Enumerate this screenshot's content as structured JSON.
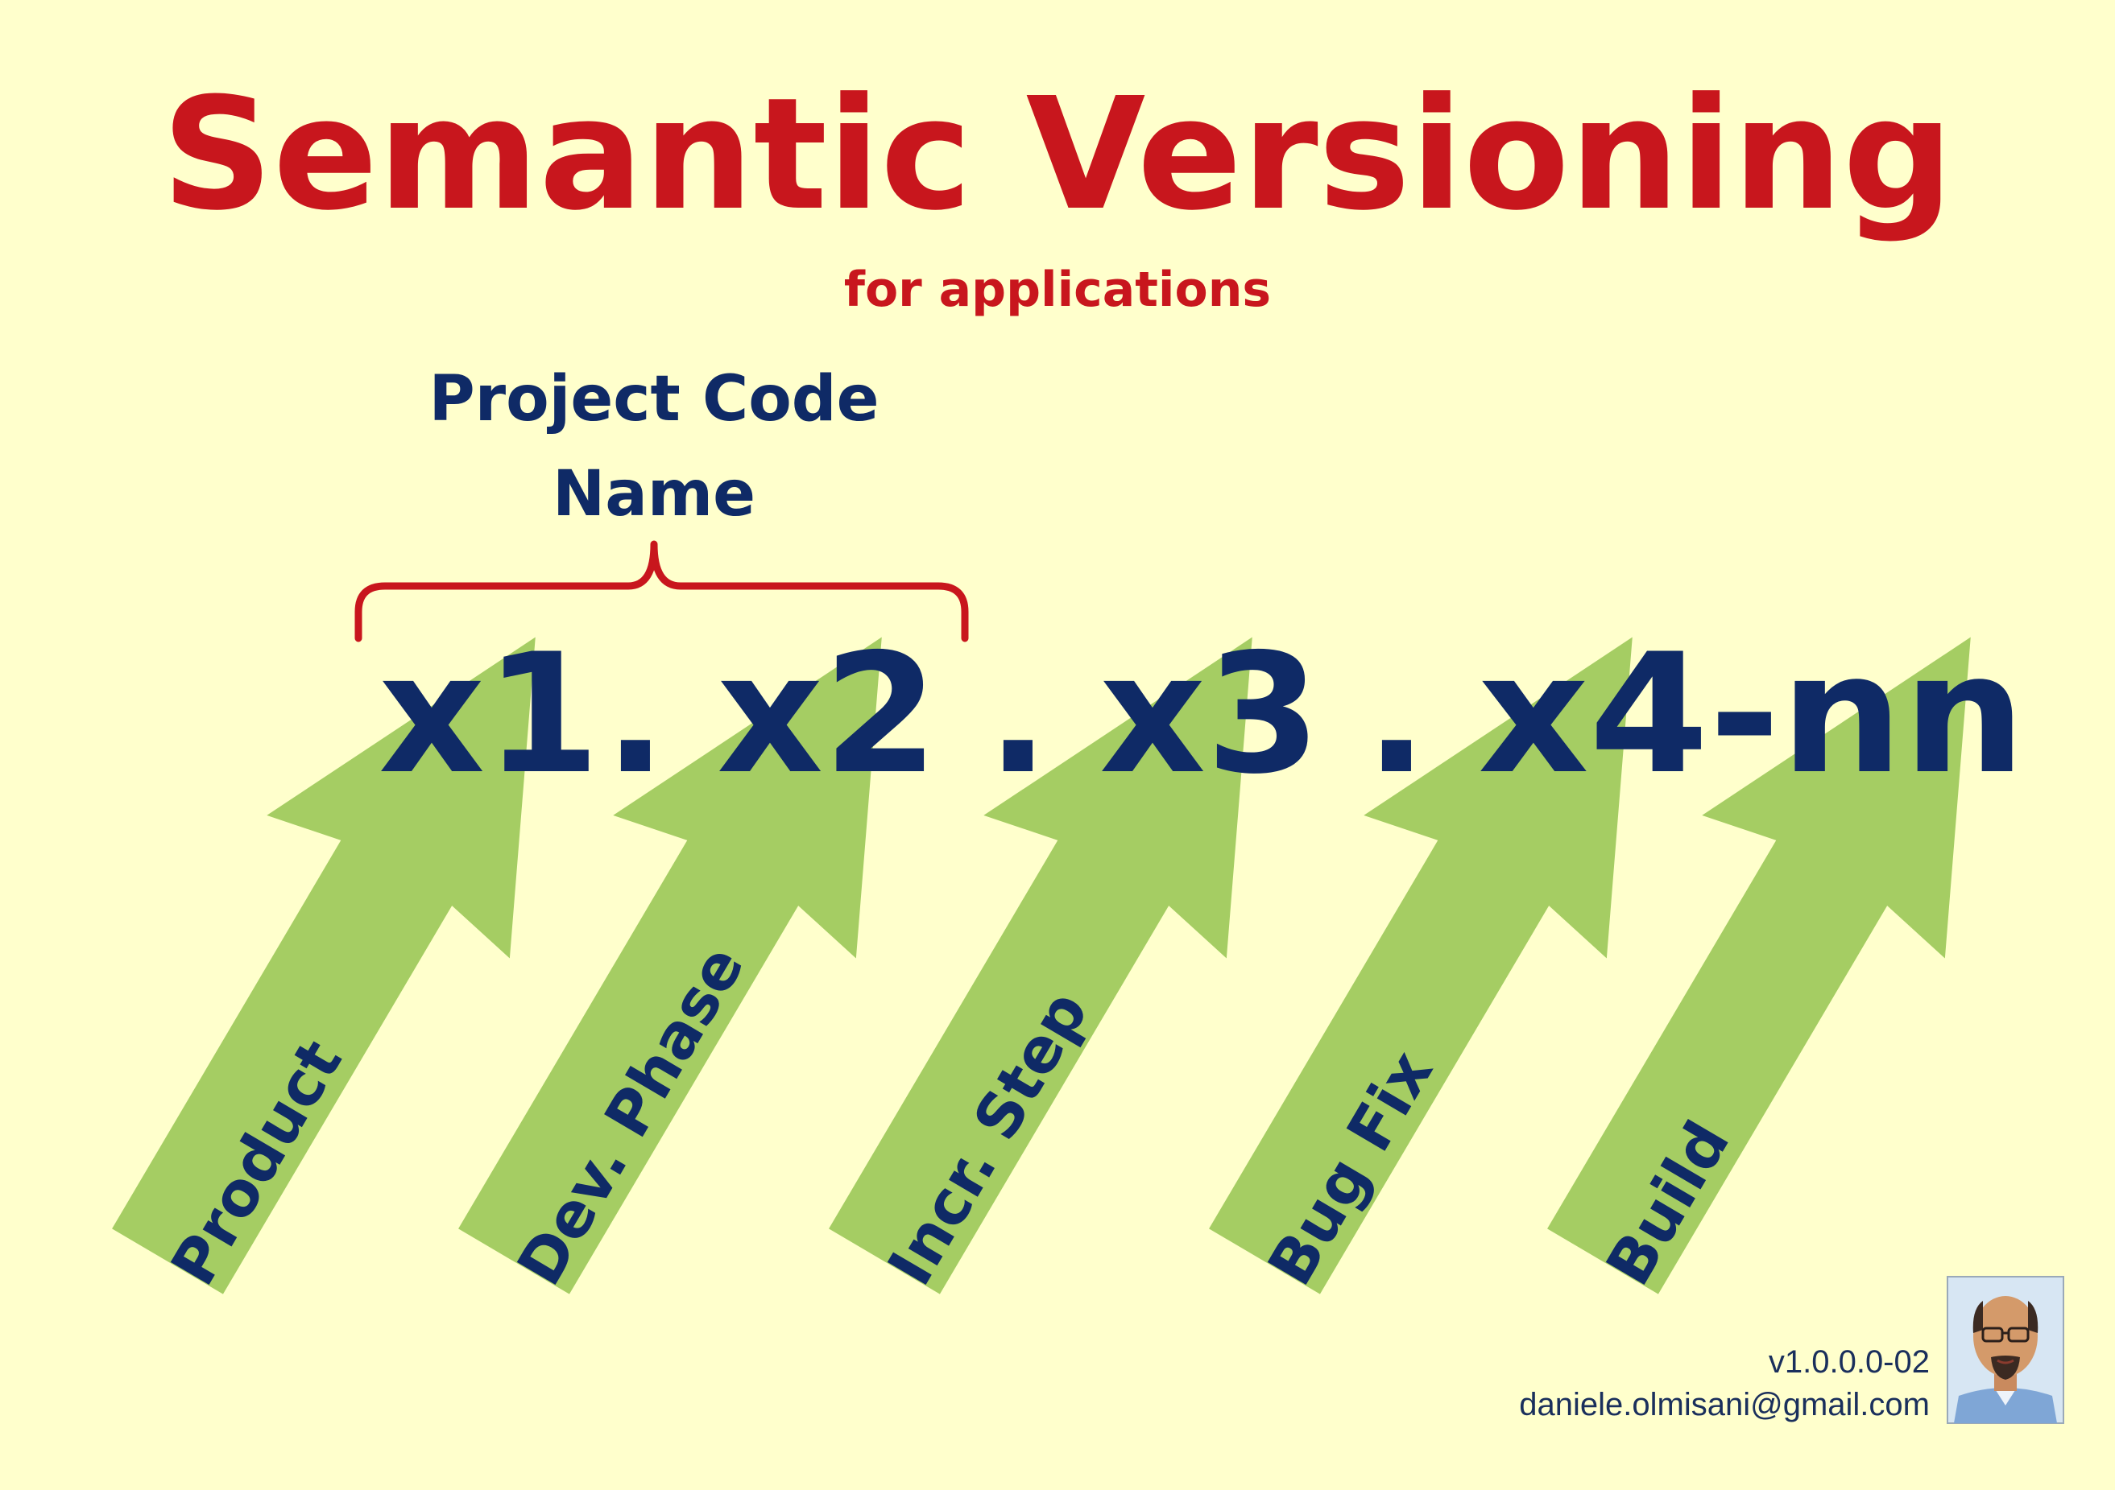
{
  "title": "Semantic Versioning",
  "subtitle": "for applications",
  "project_label": [
    "Project Code",
    "Name"
  ],
  "version_format": {
    "parts": [
      "x1",
      ".",
      "x2",
      ".",
      "x3",
      ".",
      "x4-nn"
    ]
  },
  "components": [
    {
      "label": "Product"
    },
    {
      "label": "Dev. Phase"
    },
    {
      "label": "Incr. Step"
    },
    {
      "label": "Bug Fix"
    },
    {
      "label": "Build"
    }
  ],
  "footer": {
    "version": "v1.0.0.0-02",
    "email": "daniele.olmisani@gmail.com"
  },
  "colors": {
    "background": "#FFFFCC",
    "title": "#C8161D",
    "navy": "#0F2A66",
    "arrow": "#A5CD63",
    "brace": "#C8161D"
  }
}
